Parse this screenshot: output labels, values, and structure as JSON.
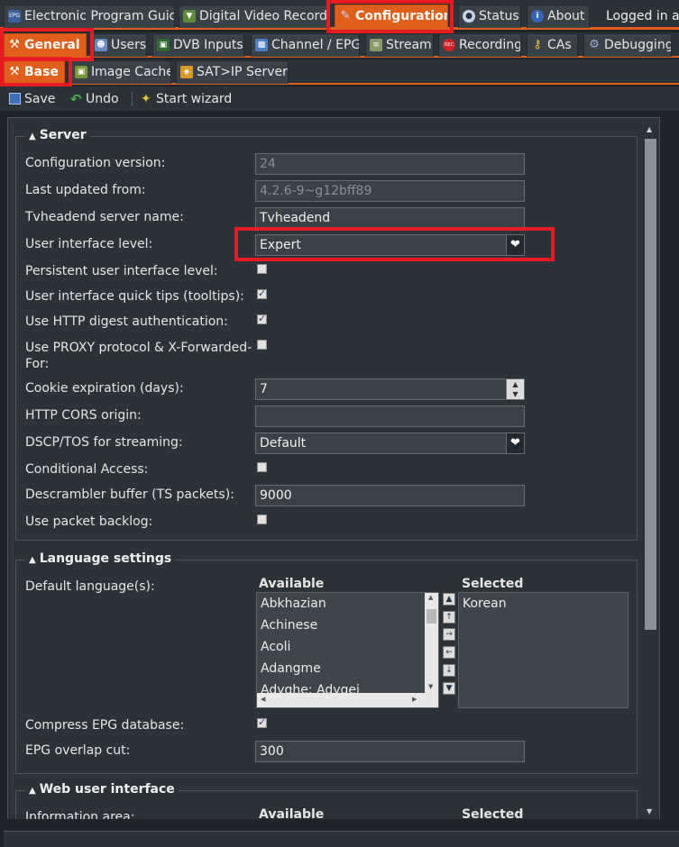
{
  "top_tabs": [
    {
      "label": "Electronic Program Guide",
      "icon": "epg-icon"
    },
    {
      "label": "Digital Video Recorder",
      "icon": "dvr-icon"
    },
    {
      "label": "Configuration",
      "icon": "wrench-icon"
    },
    {
      "label": "Status",
      "icon": "eye-icon"
    },
    {
      "label": "About",
      "icon": "info-icon"
    }
  ],
  "logged_in": "Logged in as",
  "config_tabs": [
    {
      "label": "General",
      "icon": "wrench-icon"
    },
    {
      "label": "Users",
      "icon": "users-icon"
    },
    {
      "label": "DVB Inputs",
      "icon": "dvb-icon"
    },
    {
      "label": "Channel / EPG",
      "icon": "tv-icon"
    },
    {
      "label": "Stream",
      "icon": "stream-icon"
    },
    {
      "label": "Recording",
      "icon": "rec-icon"
    },
    {
      "label": "CAs",
      "icon": "key-icon"
    },
    {
      "label": "Debugging",
      "icon": "cog-icon"
    }
  ],
  "general_tabs": [
    {
      "label": "Base",
      "icon": "wrench-icon"
    },
    {
      "label": "Image Cache",
      "icon": "image-icon"
    },
    {
      "label": "SAT>IP Server",
      "icon": "satip-icon"
    }
  ],
  "toolbar": {
    "save": "Save",
    "undo": "Undo",
    "wizard": "Start wizard"
  },
  "server": {
    "legend": "Server",
    "config_version_label": "Configuration version:",
    "config_version": "24",
    "last_updated_label": "Last updated from:",
    "last_updated": "4.2.6-9~g12bff89",
    "server_name_label": "Tvheadend server name:",
    "server_name": "Tvheadend",
    "ui_level_label": "User interface level:",
    "ui_level": "Expert",
    "persistent_label": "Persistent user interface level:",
    "tooltips_label": "User interface quick tips (tooltips):",
    "digest_label": "Use HTTP digest authentication:",
    "proxy_label_1": "Use PROXY protocol & X-Forwarded-",
    "proxy_label_2": "For:",
    "cookie_label": "Cookie expiration (days):",
    "cookie_value": "7",
    "cors_label": "HTTP CORS origin:",
    "cors_value": "",
    "dscp_label": "DSCP/TOS for streaming:",
    "dscp_value": "Default",
    "ca_label": "Conditional Access:",
    "descr_label": "Descrambler buffer (TS packets):",
    "descr_value": "9000",
    "backlog_label": "Use packet backlog:"
  },
  "language": {
    "legend": "Language settings",
    "default_label": "Default language(s):",
    "available_header": "Available",
    "selected_header": "Selected",
    "available": [
      "Abkhazian",
      "Achinese",
      "Acoli",
      "Adangme",
      "Adyghe; Adygei"
    ],
    "selected": [
      "Korean"
    ],
    "compress_label": "Compress EPG database:",
    "overlap_label": "EPG overlap cut:",
    "overlap_value": "300"
  },
  "web_ui": {
    "legend": "Web user interface",
    "info_label": "Information area:",
    "available_header": "Available",
    "selected_header": "Selected"
  }
}
